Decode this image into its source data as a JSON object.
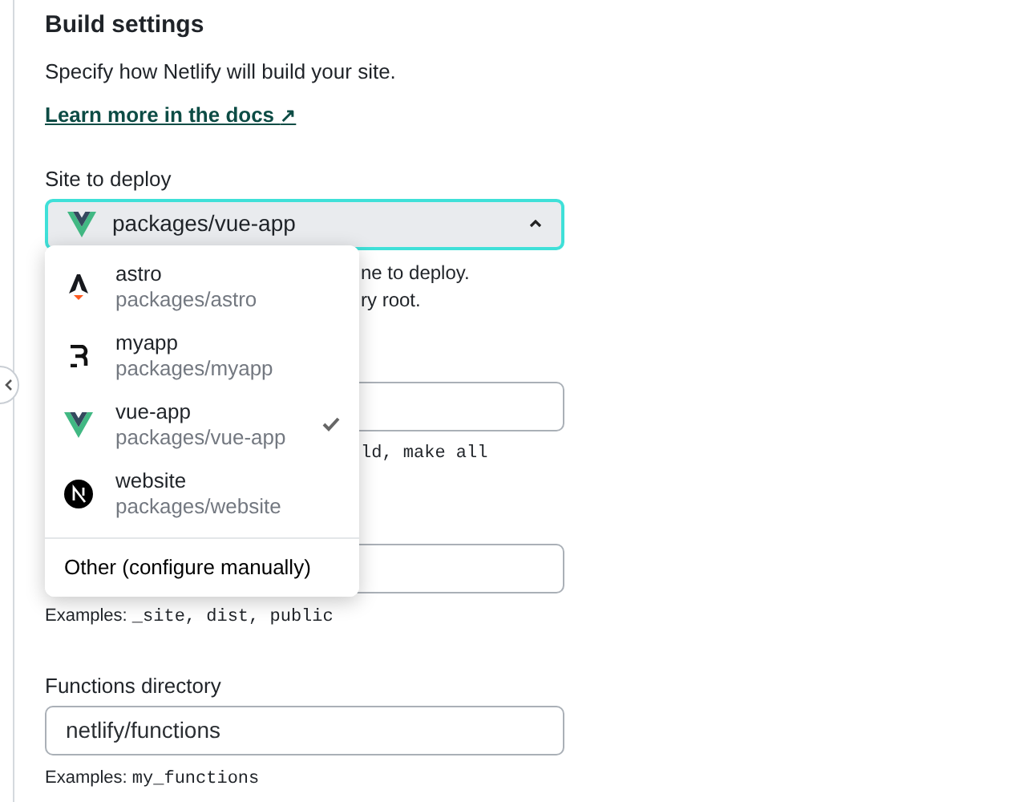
{
  "section": {
    "title": "Build settings",
    "description": "Specify how Netlify will build your site.",
    "link": "Learn more in the docs",
    "link_icon": "↗"
  },
  "site_select": {
    "label": "Site to deploy",
    "value": "packages/vue-app",
    "expanded": true,
    "hint_lines": [
      "ne to deploy.",
      "ry root."
    ]
  },
  "dropdown": {
    "options": [
      {
        "name": "astro",
        "path": "packages/astro",
        "kind": "astro",
        "selected": false
      },
      {
        "name": "myapp",
        "path": "packages/myapp",
        "kind": "remix",
        "selected": false
      },
      {
        "name": "vue-app",
        "path": "packages/vue-app",
        "kind": "vue",
        "selected": true
      },
      {
        "name": "website",
        "path": "packages/website",
        "kind": "next",
        "selected": false
      }
    ],
    "other": "Other (configure manually)"
  },
  "fields": [
    {
      "hint": "ld, make all"
    },
    {
      "hint_prefix": "Examples:",
      "hint": "_site, dist, public"
    },
    {
      "label": "Functions directory",
      "value": "netlify/functions",
      "hint_prefix": "Examples:",
      "hint": "my_functions"
    }
  ]
}
